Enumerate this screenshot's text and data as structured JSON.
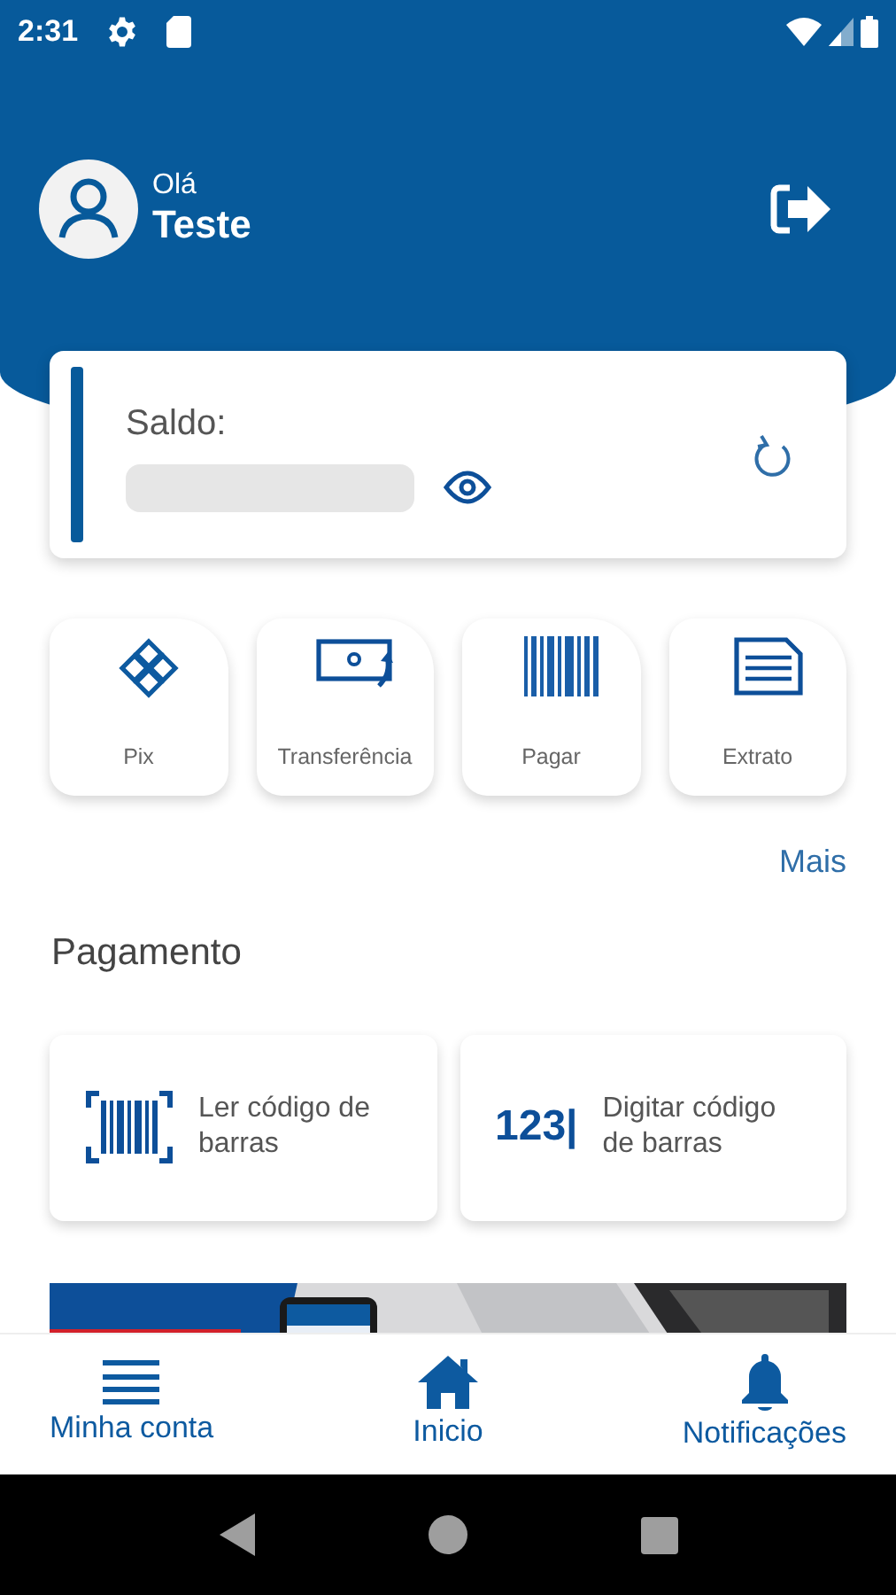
{
  "status_bar": {
    "time": "2:31"
  },
  "header": {
    "greeting": "Olá",
    "user_name": "Teste"
  },
  "balance_card": {
    "label": "Saldo:"
  },
  "shortcuts": [
    {
      "label": "Pix",
      "kind": "pix"
    },
    {
      "label": "Transferência",
      "kind": "transfer"
    },
    {
      "label": "Pagar",
      "kind": "barcode"
    },
    {
      "label": "Extrato",
      "kind": "statement"
    }
  ],
  "more_link": "Mais",
  "payment": {
    "title": "Pagamento",
    "options": [
      {
        "label": "Ler código de barras",
        "kind": "scan"
      },
      {
        "label": "Digitar código de barras",
        "kind": "type",
        "icon_text": "123|"
      }
    ]
  },
  "bottom_nav": [
    {
      "label": "Minha conta",
      "kind": "menu"
    },
    {
      "label": "Inicio",
      "kind": "home"
    },
    {
      "label": "Notificações",
      "kind": "bell"
    }
  ]
}
